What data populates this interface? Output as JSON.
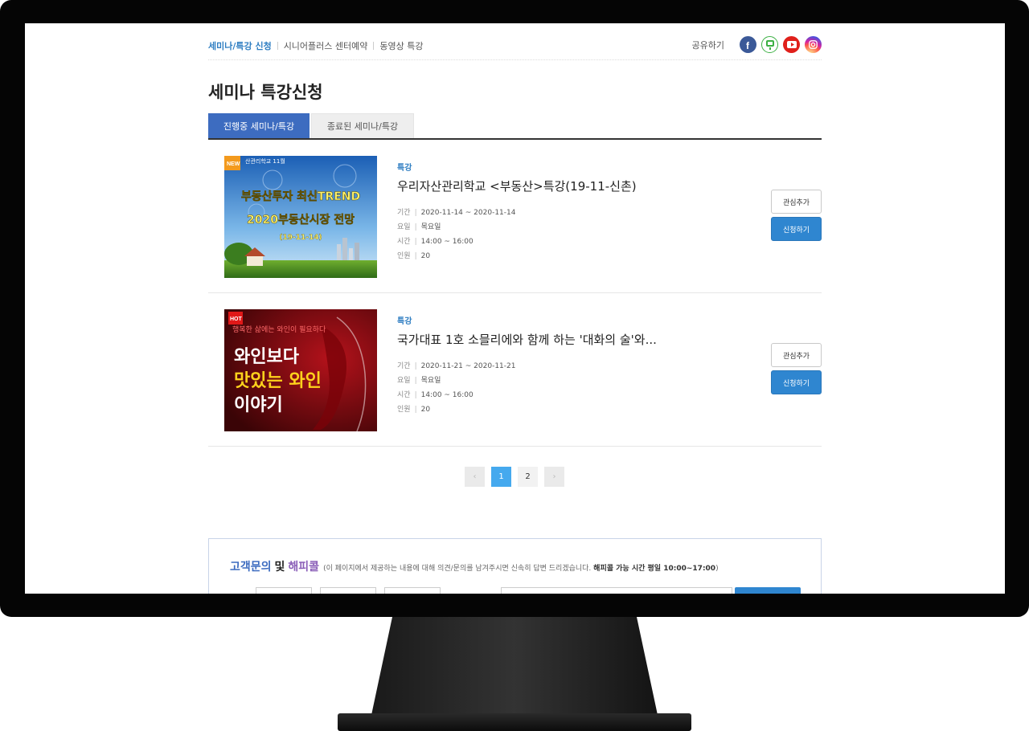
{
  "nav": {
    "crumbs": [
      "세미나/특강 신청",
      "시니어플러스 센터예약",
      "동영상 특강"
    ],
    "share_label": "공유하기",
    "sns": [
      "facebook-icon",
      "line-icon",
      "youtube-icon",
      "instagram-icon"
    ]
  },
  "page_title": "세미나 특강신청",
  "tabs": [
    "진행중 세미나/특강",
    "종료된 세미나/특강"
  ],
  "items": [
    {
      "badge": "NEW",
      "thumb_lines": [
        "산관리학교 11월",
        "부동산투자 최신TREND",
        "2020부동산시장 전망",
        "(19-11-14)"
      ],
      "category": "특강",
      "title": "우리자산관리학교 <부동산>특강(19-11-신촌)",
      "period_label": "기간",
      "period": "2020-11-14 ~ 2020-11-14",
      "day_label": "요일",
      "day": "목요일",
      "time_label": "시간",
      "time": "14:00 ~ 16:00",
      "people_label": "인원",
      "people": "20",
      "like_label": "관심추가",
      "apply_label": "신청하기"
    },
    {
      "badge": "HOT",
      "thumb_lines": [
        "행복한 삶에는 와인이 필요하다",
        "와인보다",
        "맛있는 와인",
        "이야기"
      ],
      "category": "특강",
      "title": "국가대표 1호 소믈리에와 함께 하는 '대화의 술'와...",
      "period_label": "기간",
      "period": "2020-11-21 ~ 2020-11-21",
      "day_label": "요일",
      "day": "목요일",
      "time_label": "시간",
      "time": "14:00 ~ 16:00",
      "people_label": "인원",
      "people": "20",
      "like_label": "관심추가",
      "apply_label": "신청하기"
    }
  ],
  "pagination": {
    "prev": "‹",
    "pages": [
      "1",
      "2"
    ],
    "current": "1",
    "next": "›"
  },
  "contact": {
    "title_a": "고객문의",
    "title_and": "및",
    "title_b": "해피콜",
    "desc": "(이 페이지에서 제공하는 내용에 대해 의견/문의를 남겨주시면 신속히 답변 드리겠습니다.",
    "desc_bold": "해피콜 가능 시간 평일 10:00~17:00",
    "desc_end": ")"
  }
}
